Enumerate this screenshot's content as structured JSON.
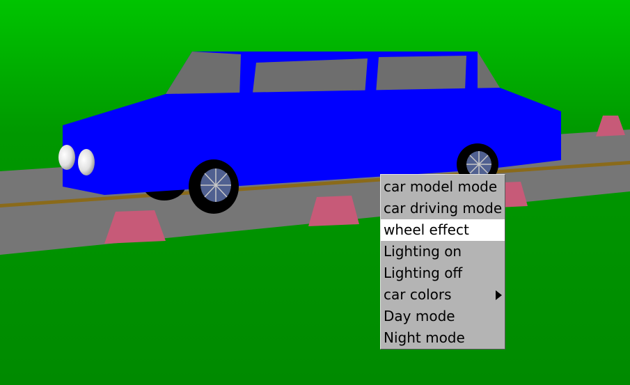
{
  "scene": {
    "sky_colors": [
      "#00c800",
      "#008c00"
    ],
    "grass_color": "#008c00",
    "road_color": "#7a7a7a",
    "road_line_color": "#8a6a1a",
    "cone_color": "#c75a78",
    "car_body_color": "#0000ff",
    "car_window_color": "#6e6e6e",
    "wheel_color": "#000000",
    "hubcap_color": "#506090",
    "headlight_color": "#ffffff"
  },
  "context_menu": {
    "items": [
      {
        "label": "car model mode",
        "highlighted": false,
        "submenu": false
      },
      {
        "label": "car driving mode",
        "highlighted": false,
        "submenu": false
      },
      {
        "label": "wheel effect",
        "highlighted": true,
        "submenu": false
      },
      {
        "label": "Lighting on",
        "highlighted": false,
        "submenu": false
      },
      {
        "label": "Lighting off",
        "highlighted": false,
        "submenu": false
      },
      {
        "label": "car colors",
        "highlighted": false,
        "submenu": true,
        "submenu_icon": "triangle-right-icon"
      },
      {
        "label": "Day mode",
        "highlighted": false,
        "submenu": false
      },
      {
        "label": "Night mode",
        "highlighted": false,
        "submenu": false
      }
    ]
  }
}
